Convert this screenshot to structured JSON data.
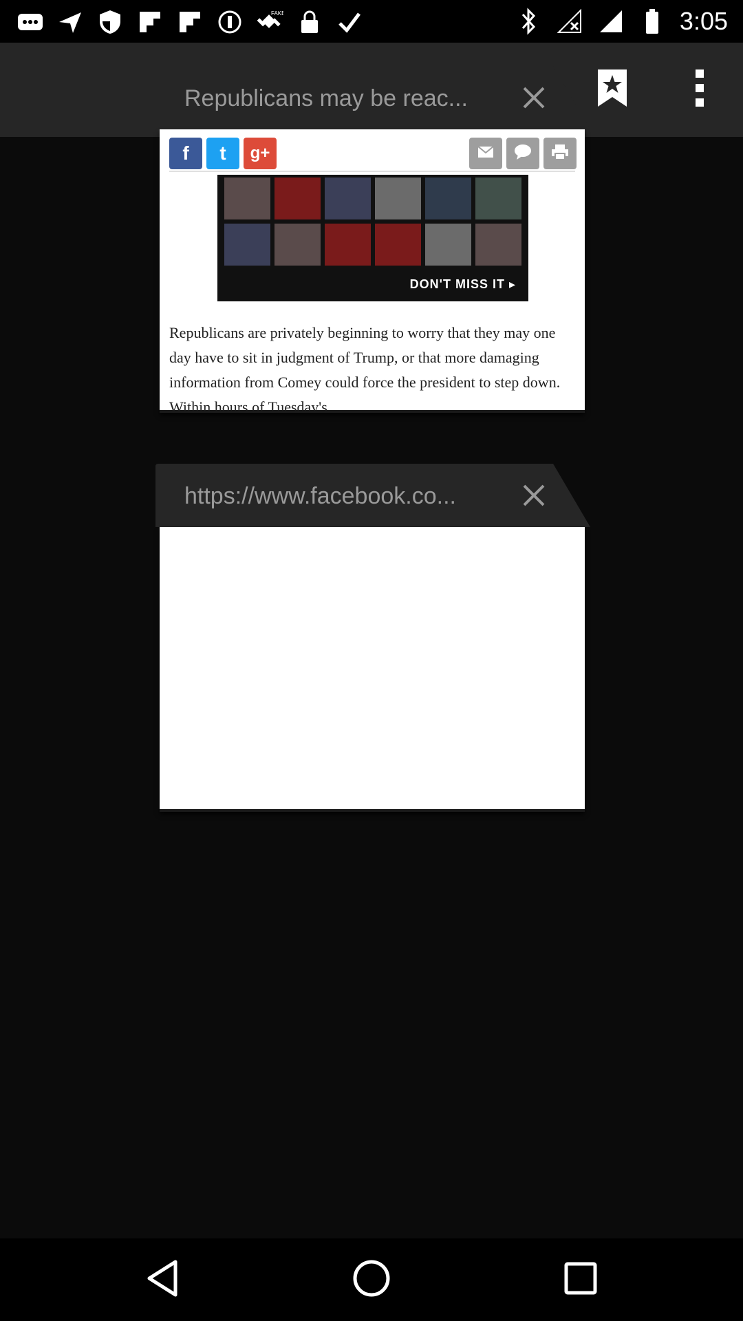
{
  "status_bar": {
    "time": "3:05",
    "left_icons": [
      "messages-icon",
      "navigation-icon",
      "shield-icon",
      "flipboard-icon",
      "flipboard-icon",
      "settings-circle-icon",
      "fake-gps-icon",
      "lock-icon",
      "check-icon"
    ],
    "right_icons": [
      "bluetooth-icon",
      "no-signal-icon",
      "signal-icon",
      "battery-icon"
    ]
  },
  "toolbar": {
    "new_tab_icon": "plus-icon",
    "bookmarks_icon": "bookmark-star-icon",
    "menu_icon": "overflow-menu-icon"
  },
  "tabs": [
    {
      "title": "Republicans may be reac...",
      "share_buttons": [
        "f",
        "t",
        "g+"
      ],
      "promo_cta": "DON'T MISS IT ▸",
      "article_text": "Republicans are privately beginning to worry that they may one day have to sit in judgment of Trump, or that more damaging information from Comey could force the president to step down. Within hours of Tuesday's"
    },
    {
      "title": "https://www.facebook.co..."
    }
  ],
  "colors": {
    "facebook": "#3b5998",
    "twitter": "#1da1f2",
    "google_plus": "#dd4b39",
    "background": "#0b0b0b",
    "toolbar": "#262626"
  },
  "nav_bar": {
    "icons": [
      "back-icon",
      "home-icon",
      "recents-icon"
    ]
  }
}
